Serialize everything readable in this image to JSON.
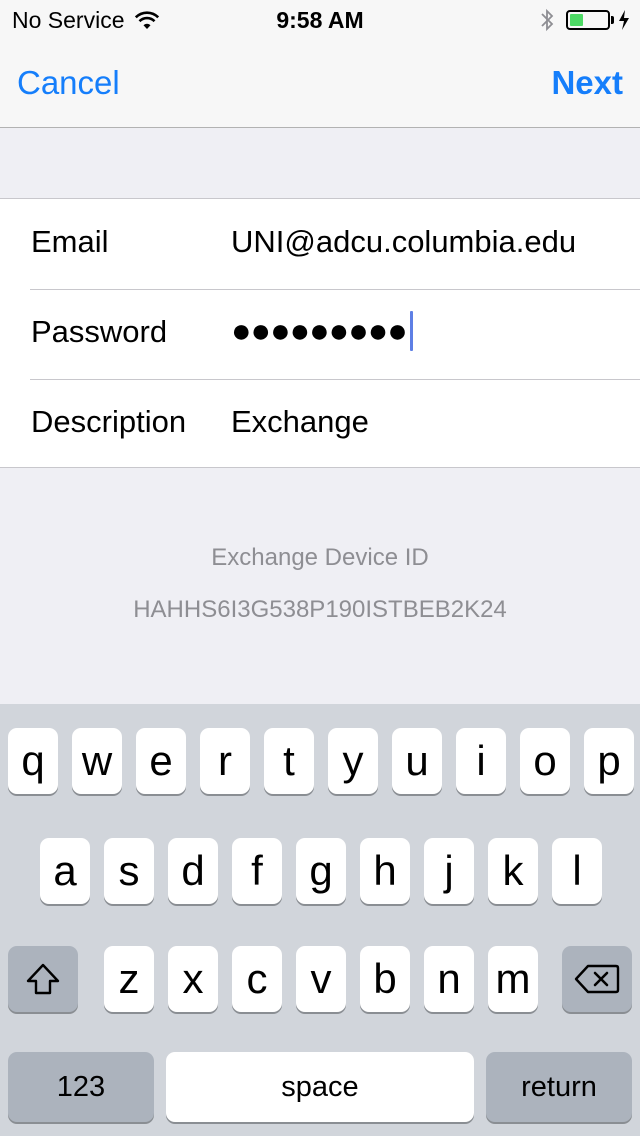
{
  "status_bar": {
    "carrier": "No Service",
    "time": "9:58 AM",
    "battery_level": 0.35,
    "battery_color": "#4cd964"
  },
  "nav": {
    "cancel_label": "Cancel",
    "next_label": "Next"
  },
  "form": {
    "email_label": "Email",
    "email_value": "UNI@adcu.columbia.edu",
    "password_label": "Password",
    "password_value": "●●●●●●●●●",
    "description_label": "Description",
    "description_value": "Exchange"
  },
  "device_id": {
    "title": "Exchange Device ID",
    "value": "HAHHS6I3G538P190ISTBEB2K24"
  },
  "keyboard": {
    "row1": [
      "q",
      "w",
      "e",
      "r",
      "t",
      "y",
      "u",
      "i",
      "o",
      "p"
    ],
    "row2": [
      "a",
      "s",
      "d",
      "f",
      "g",
      "h",
      "j",
      "k",
      "l"
    ],
    "row3": [
      "z",
      "x",
      "c",
      "v",
      "b",
      "n",
      "m"
    ],
    "numbers_label": "123",
    "space_label": "space",
    "return_label": "return",
    "shift_icon": "shift-icon",
    "delete_icon": "delete-icon"
  },
  "colors": {
    "accent": "#157efb",
    "caret": "#5e7fe5",
    "keyboard_bg": "#d1d5db"
  }
}
